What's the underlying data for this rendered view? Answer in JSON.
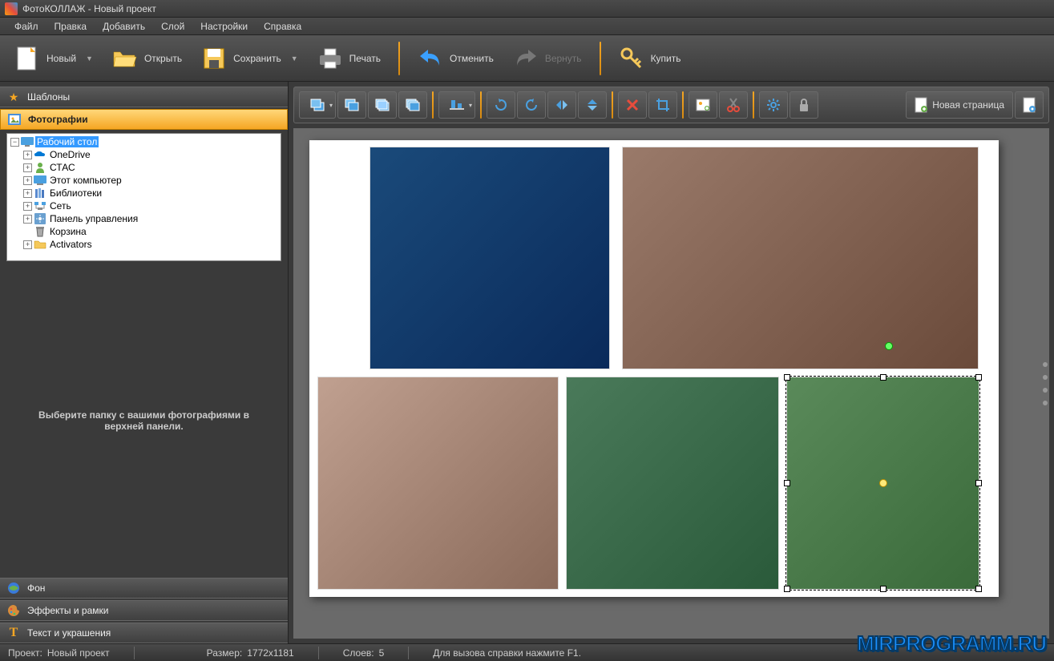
{
  "title": "ФотоКОЛЛАЖ - Новый проект",
  "menu": [
    "Файл",
    "Правка",
    "Добавить",
    "Слой",
    "Настройки",
    "Справка"
  ],
  "toolbar": {
    "new": "Новый",
    "open": "Открыть",
    "save": "Сохранить",
    "print": "Печать",
    "undo": "Отменить",
    "redo": "Вернуть",
    "buy": "Купить"
  },
  "sidebar": {
    "templates": "Шаблоны",
    "photos": "Фотографии",
    "background": "Фон",
    "effects": "Эффекты и рамки",
    "text": "Текст и украшения",
    "hint": "Выберите папку с вашими фотографиями в верхней панели."
  },
  "tree": [
    {
      "label": "Рабочий стол",
      "kind": "desktop",
      "indent": 0,
      "selected": true,
      "expandable": true,
      "expanded": true
    },
    {
      "label": "OneDrive",
      "kind": "onedrive",
      "indent": 1,
      "expandable": true
    },
    {
      "label": "СТАС",
      "kind": "user",
      "indent": 1,
      "expandable": true
    },
    {
      "label": "Этот компьютер",
      "kind": "pc",
      "indent": 1,
      "expandable": true
    },
    {
      "label": "Библиотеки",
      "kind": "lib",
      "indent": 1,
      "expandable": true
    },
    {
      "label": "Сеть",
      "kind": "net",
      "indent": 1,
      "expandable": true
    },
    {
      "label": "Панель управления",
      "kind": "cp",
      "indent": 1,
      "expandable": true
    },
    {
      "label": "Корзина",
      "kind": "bin",
      "indent": 1,
      "expandable": false
    },
    {
      "label": "Activators",
      "kind": "folder",
      "indent": 1,
      "expandable": true
    }
  ],
  "canvas_toolbar": {
    "new_page": "Новая страница"
  },
  "status": {
    "project_label": "Проект:",
    "project_value": "Новый проект",
    "size_label": "Размер:",
    "size_value": "1772x1181",
    "layers_label": "Слоев:",
    "layers_value": "5",
    "help": "Для вызова справки нажмите F1."
  },
  "watermark": "MIRPROGRAMM.RU"
}
